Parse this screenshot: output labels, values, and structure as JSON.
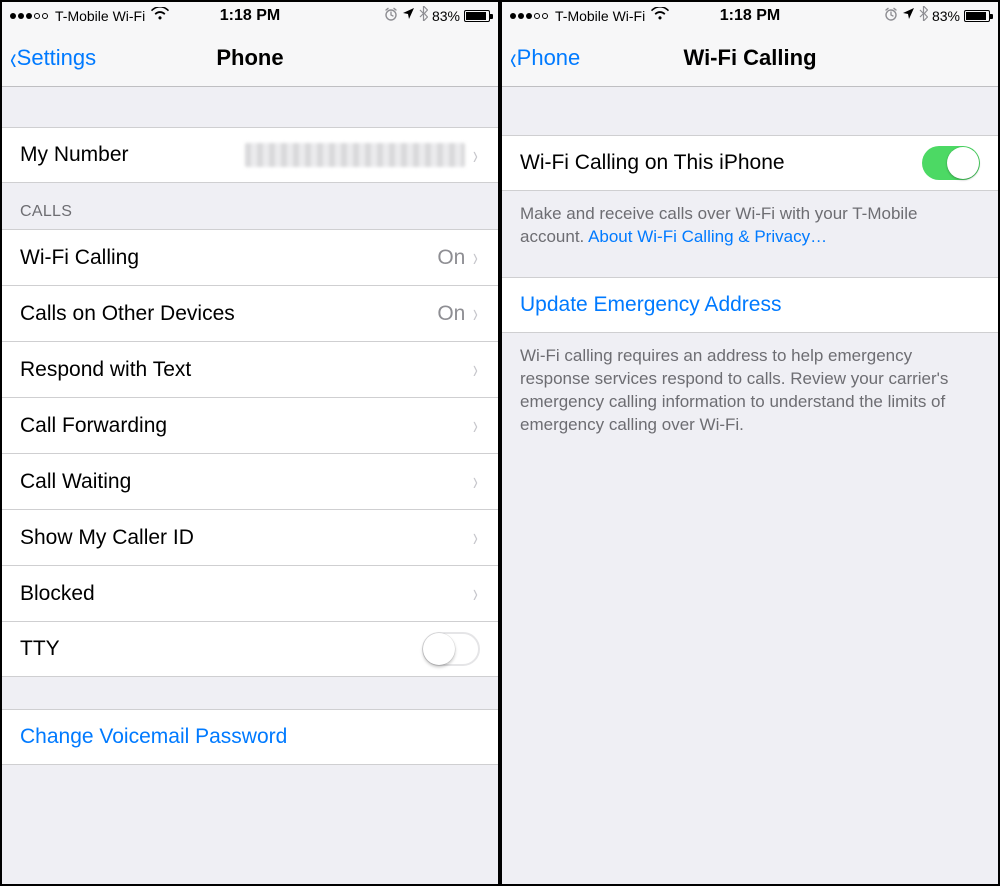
{
  "statusBar": {
    "carrier": "T-Mobile Wi-Fi",
    "time": "1:18 PM",
    "batteryPercent": "83%"
  },
  "left": {
    "back": "Settings",
    "title": "Phone",
    "myNumberLabel": "My Number",
    "callsHeader": "CALLS",
    "rows": {
      "wifiCalling": {
        "label": "Wi-Fi Calling",
        "value": "On"
      },
      "otherDevices": {
        "label": "Calls on Other Devices",
        "value": "On"
      },
      "respondText": {
        "label": "Respond with Text"
      },
      "callForwarding": {
        "label": "Call Forwarding"
      },
      "callWaiting": {
        "label": "Call Waiting"
      },
      "showCallerId": {
        "label": "Show My Caller ID"
      },
      "blocked": {
        "label": "Blocked"
      },
      "tty": {
        "label": "TTY",
        "on": false
      }
    },
    "changeVoicemail": "Change Voicemail Password"
  },
  "right": {
    "back": "Phone",
    "title": "Wi-Fi Calling",
    "toggleRow": {
      "label": "Wi-Fi Calling on This iPhone",
      "on": true
    },
    "footer1": "Make and receive calls over Wi-Fi with your T-Mobile account. ",
    "footer1Link": "About Wi-Fi Calling & Privacy…",
    "updateEmergency": "Update Emergency Address",
    "footer2": "Wi-Fi calling requires an address to help emergency response services respond to calls. Review your carrier's emergency calling information to understand the limits of emergency calling over Wi-Fi."
  }
}
